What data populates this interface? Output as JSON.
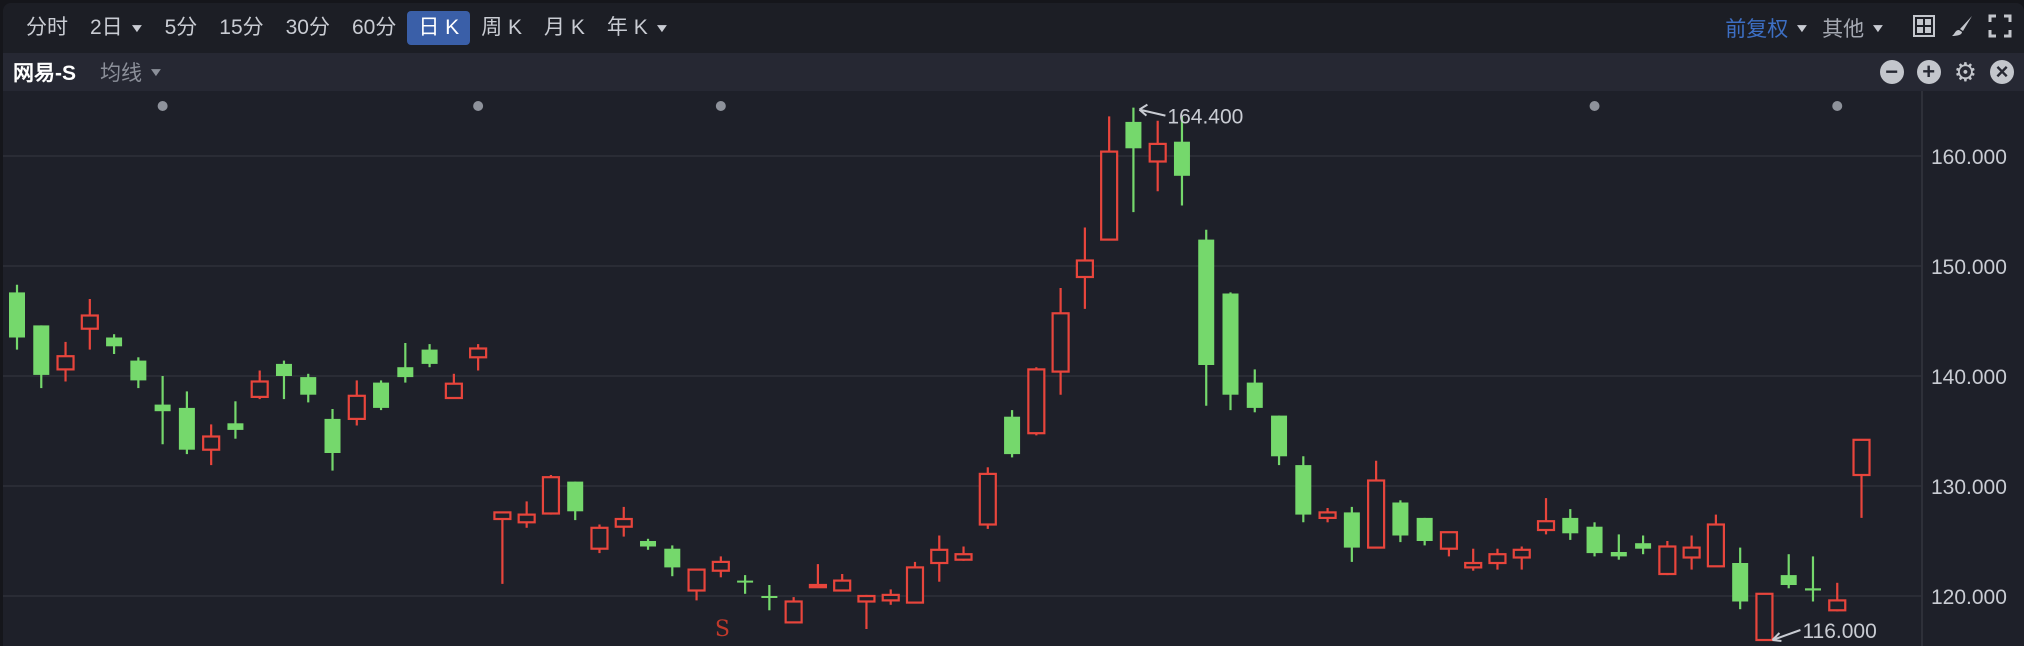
{
  "toolbar": {
    "periods": [
      {
        "label": "分时",
        "dropdown": false,
        "active": false
      },
      {
        "label": "2日",
        "dropdown": true,
        "active": false
      },
      {
        "label": "5分",
        "dropdown": false,
        "active": false
      },
      {
        "label": "15分",
        "dropdown": false,
        "active": false
      },
      {
        "label": "30分",
        "dropdown": false,
        "active": false
      },
      {
        "label": "60分",
        "dropdown": false,
        "active": false
      },
      {
        "label": "日 K",
        "dropdown": false,
        "active": true
      },
      {
        "label": "周 K",
        "dropdown": false,
        "active": false
      },
      {
        "label": "月 K",
        "dropdown": false,
        "active": false
      },
      {
        "label": "年 K",
        "dropdown": true,
        "active": false
      }
    ],
    "adjust_label": "前复权",
    "other_label": "其他",
    "icons": [
      "layout-grid-icon",
      "brush-icon",
      "fullscreen-icon"
    ]
  },
  "subbar": {
    "stock_name": "网易-S",
    "indicator_label": "均线",
    "icons": [
      "zoom-out-icon",
      "zoom-in-icon",
      "settings-icon",
      "close-icon"
    ]
  },
  "colors": {
    "up": "#e8453c",
    "down": "#75d86c",
    "accent": "#3a5fa8",
    "background": "#1e2029"
  },
  "chart_data": {
    "type": "candlestick",
    "y_ticks": [
      "160.000",
      "150.000",
      "140.000",
      "130.000",
      "120.000"
    ],
    "y_tick_values": [
      160,
      150,
      140,
      130,
      120
    ],
    "ylim": [
      115.1,
      168.6
    ],
    "max_annotation": {
      "label": "164.400",
      "value": 164.4,
      "index": 46
    },
    "min_annotation": {
      "label": "116.000",
      "value": 116.0,
      "index": 72
    },
    "marker": {
      "label": "S",
      "index": 29
    },
    "top_dot_indices": [
      6,
      19,
      29,
      65,
      75
    ],
    "candles_ohlc": [
      [
        147.6,
        143.5,
        148.3,
        142.4
      ],
      [
        144.6,
        140.1,
        144.6,
        138.9
      ],
      [
        140.6,
        141.8,
        143.1,
        139.5
      ],
      [
        144.3,
        145.5,
        147.0,
        142.4
      ],
      [
        143.5,
        142.7,
        143.8,
        142.0
      ],
      [
        141.4,
        139.6,
        141.7,
        138.9
      ],
      [
        137.4,
        136.8,
        140.0,
        133.8
      ],
      [
        137.1,
        133.3,
        138.6,
        132.9
      ],
      [
        133.3,
        134.5,
        135.6,
        131.9
      ],
      [
        135.7,
        135.1,
        137.7,
        134.3
      ],
      [
        138.1,
        139.5,
        140.5,
        137.9
      ],
      [
        141.1,
        140.0,
        141.4,
        137.9
      ],
      [
        139.9,
        138.3,
        140.2,
        137.6
      ],
      [
        136.1,
        133.0,
        137.0,
        131.4
      ],
      [
        136.1,
        138.2,
        139.6,
        135.5
      ],
      [
        139.4,
        137.1,
        139.6,
        136.9
      ],
      [
        140.8,
        139.9,
        143.0,
        139.4
      ],
      [
        142.4,
        141.1,
        142.9,
        140.8
      ],
      [
        138.0,
        139.3,
        140.2,
        138.0
      ],
      [
        141.7,
        142.5,
        142.9,
        140.5
      ],
      [
        127.0,
        127.6,
        127.6,
        121.1
      ],
      [
        126.7,
        127.4,
        128.6,
        126.2
      ],
      [
        127.5,
        130.8,
        131.0,
        127.4
      ],
      [
        130.4,
        127.7,
        130.4,
        126.9
      ],
      [
        124.3,
        126.2,
        126.5,
        123.9
      ],
      [
        126.3,
        127.0,
        128.1,
        125.4
      ],
      [
        125.0,
        124.5,
        125.2,
        124.2
      ],
      [
        124.3,
        122.6,
        124.6,
        121.8
      ],
      [
        120.5,
        122.4,
        122.5,
        119.6
      ],
      [
        122.3,
        123.1,
        123.6,
        121.7
      ],
      [
        121.4,
        121.3,
        121.9,
        120.2
      ],
      [
        120.0,
        119.9,
        121.0,
        118.7
      ],
      [
        117.6,
        119.5,
        119.9,
        117.6
      ],
      [
        120.8,
        121.0,
        122.9,
        120.8
      ],
      [
        120.5,
        121.4,
        122.0,
        120.5
      ],
      [
        119.5,
        120.0,
        120.1,
        117.0
      ],
      [
        119.6,
        120.1,
        120.6,
        119.2
      ],
      [
        119.4,
        122.6,
        123.1,
        119.4
      ],
      [
        123.0,
        124.2,
        125.5,
        121.3
      ],
      [
        123.3,
        123.8,
        124.5,
        123.2
      ],
      [
        126.5,
        131.1,
        131.7,
        126.1
      ],
      [
        136.3,
        132.9,
        136.9,
        132.6
      ],
      [
        134.8,
        140.6,
        140.8,
        134.6
      ],
      [
        140.4,
        145.7,
        148.0,
        138.3
      ],
      [
        149.0,
        150.5,
        153.5,
        146.1
      ],
      [
        152.4,
        160.4,
        163.6,
        152.4
      ],
      [
        163.1,
        160.7,
        164.4,
        154.9
      ],
      [
        159.5,
        161.1,
        163.2,
        156.8
      ],
      [
        161.3,
        158.2,
        163.6,
        155.5
      ],
      [
        152.4,
        141.0,
        153.3,
        137.3
      ],
      [
        147.5,
        138.3,
        147.6,
        136.9
      ],
      [
        139.4,
        137.1,
        140.6,
        136.7
      ],
      [
        136.4,
        132.7,
        136.4,
        131.9
      ],
      [
        131.9,
        127.4,
        132.7,
        126.7
      ],
      [
        127.1,
        127.6,
        128.0,
        126.7
      ],
      [
        127.6,
        124.4,
        128.1,
        123.1
      ],
      [
        124.4,
        130.5,
        132.3,
        124.4
      ],
      [
        128.5,
        125.5,
        128.7,
        124.9
      ],
      [
        127.1,
        125.0,
        127.1,
        124.6
      ],
      [
        124.3,
        125.8,
        125.8,
        123.6
      ],
      [
        122.6,
        123.0,
        124.3,
        122.3
      ],
      [
        123.0,
        123.8,
        124.3,
        122.4
      ],
      [
        123.5,
        124.2,
        124.5,
        122.4
      ],
      [
        126.0,
        126.8,
        128.9,
        125.6
      ],
      [
        127.1,
        125.7,
        127.9,
        125.1
      ],
      [
        126.3,
        123.9,
        126.7,
        123.6
      ],
      [
        124.0,
        123.6,
        125.6,
        123.3
      ],
      [
        124.8,
        124.3,
        125.5,
        123.8
      ],
      [
        122.0,
        124.5,
        125.0,
        121.9
      ],
      [
        123.5,
        124.4,
        125.5,
        122.4
      ],
      [
        122.7,
        126.5,
        127.4,
        122.7
      ],
      [
        123.0,
        119.5,
        124.4,
        118.8
      ],
      [
        116.0,
        120.2,
        120.2,
        116.0
      ],
      [
        121.9,
        121.0,
        123.8,
        120.7
      ],
      [
        120.7,
        120.5,
        123.6,
        119.5
      ],
      [
        118.7,
        119.6,
        121.2,
        118.6
      ],
      [
        131.0,
        134.2,
        134.2,
        127.1
      ]
    ]
  }
}
